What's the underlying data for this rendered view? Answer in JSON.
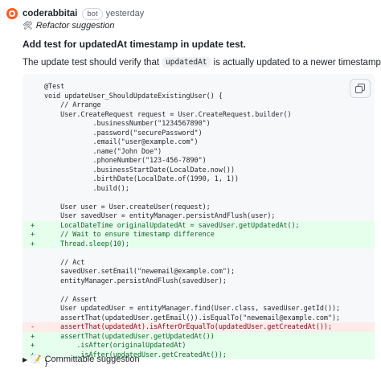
{
  "comment": {
    "author": "coderabbitai",
    "badge": "bot",
    "time": "yesterday",
    "tag_icon": "tools-icon",
    "tag": "Refactor suggestion",
    "title": "Add test for updatedAt timestamp in update test.",
    "description_before": "The update test should verify that",
    "description_code": "updatedAt",
    "description_after": "is actually updated to a newer timestamp."
  },
  "code_lines": [
    {
      "type": "ctx",
      "marker": "",
      "text": "@Test"
    },
    {
      "type": "ctx",
      "marker": "",
      "text": "void updateUser_ShouldUpdateExistingUser() {"
    },
    {
      "type": "ctx",
      "marker": "",
      "text": "    // Arrange"
    },
    {
      "type": "ctx",
      "marker": "",
      "text": "    User.CreateRequest request = User.CreateRequest.builder()"
    },
    {
      "type": "ctx",
      "marker": "",
      "text": "            .businessNumber(\"1234567890\")"
    },
    {
      "type": "ctx",
      "marker": "",
      "text": "            .password(\"securePassword\")"
    },
    {
      "type": "ctx",
      "marker": "",
      "text": "            .email(\"user@example.com\")"
    },
    {
      "type": "ctx",
      "marker": "",
      "text": "            .name(\"John Doe\")"
    },
    {
      "type": "ctx",
      "marker": "",
      "text": "            .phoneNumber(\"123-456-7890\")"
    },
    {
      "type": "ctx",
      "marker": "",
      "text": "            .businessStartDate(LocalDate.now())"
    },
    {
      "type": "ctx",
      "marker": "",
      "text": "            .birthDate(LocalDate.of(1990, 1, 1))"
    },
    {
      "type": "ctx",
      "marker": "",
      "text": "            .build();"
    },
    {
      "type": "ctx",
      "marker": "",
      "text": ""
    },
    {
      "type": "ctx",
      "marker": "",
      "text": "    User user = User.createUser(request);"
    },
    {
      "type": "ctx",
      "marker": "",
      "text": "    User savedUser = entityManager.persistAndFlush(user);"
    },
    {
      "type": "add",
      "marker": "+",
      "text": "    LocalDateTime originalUpdatedAt = savedUser.getUpdatedAt();"
    },
    {
      "type": "add",
      "marker": "+",
      "text": "    // Wait to ensure timestamp difference"
    },
    {
      "type": "add",
      "marker": "+",
      "text": "    Thread.sleep(10);"
    },
    {
      "type": "ctx",
      "marker": "",
      "text": ""
    },
    {
      "type": "ctx",
      "marker": "",
      "text": "    // Act"
    },
    {
      "type": "ctx",
      "marker": "",
      "text": "    savedUser.setEmail(\"newemail@example.com\");"
    },
    {
      "type": "ctx",
      "marker": "",
      "text": "    entityManager.persistAndFlush(savedUser);"
    },
    {
      "type": "ctx",
      "marker": "",
      "text": ""
    },
    {
      "type": "ctx",
      "marker": "",
      "text": "    // Assert"
    },
    {
      "type": "ctx",
      "marker": "",
      "text": "    User updatedUser = entityManager.find(User.class, savedUser.getId());"
    },
    {
      "type": "ctx",
      "marker": "",
      "text": "    assertThat(updatedUser.getEmail()).isEqualTo(\"newemail@example.com\");"
    },
    {
      "type": "del",
      "marker": "-",
      "text": "    assertThat(updatedAt).isAfterOrEqualTo(updatedUser.getCreatedAt());"
    },
    {
      "type": "add",
      "marker": "+",
      "text": "    assertThat(updatedUser.getUpdatedAt())"
    },
    {
      "type": "add",
      "marker": "+",
      "text": "        .isAfter(originalUpdatedAt)"
    },
    {
      "type": "add",
      "marker": "+",
      "text": "        .isAfter(updatedUser.getCreatedAt());"
    },
    {
      "type": "ctx",
      "marker": "",
      "text": "}"
    }
  ],
  "copy_icon": "copy-icon",
  "footer": {
    "toggle_icon": "triangle-right-icon",
    "icon": "suggestion-icon",
    "label": "Committable suggestion"
  }
}
